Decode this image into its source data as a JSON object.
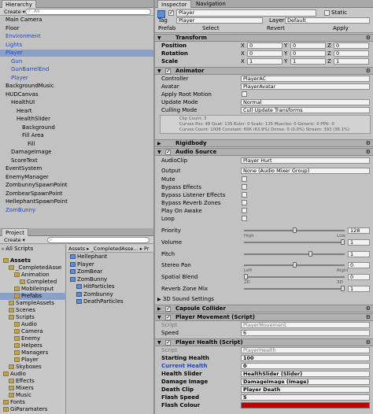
{
  "hierarchy": {
    "tab": "Hierarchy",
    "create": "Create ▾",
    "search_placeholder": "All",
    "items": [
      {
        "label": "Main Camera",
        "indent": 0,
        "blue": false,
        "selected": false
      },
      {
        "label": "Floor",
        "indent": 0,
        "blue": false,
        "selected": false
      },
      {
        "label": "Environment",
        "indent": 0,
        "blue": true,
        "selected": false
      },
      {
        "label": "Lights",
        "indent": 0,
        "blue": true,
        "selected": false
      },
      {
        "label": "Player",
        "indent": 0,
        "blue": true,
        "selected": true
      },
      {
        "label": "Gun",
        "indent": 1,
        "blue": true,
        "selected": false
      },
      {
        "label": "GunBarrelEnd",
        "indent": 1,
        "blue": true,
        "selected": false
      },
      {
        "label": "Player",
        "indent": 1,
        "blue": true,
        "selected": false
      },
      {
        "label": "BackgroundMusic",
        "indent": 0,
        "blue": false,
        "selected": false
      },
      {
        "label": "HUDCanvas",
        "indent": 0,
        "blue": false,
        "selected": false
      },
      {
        "label": "HealthUI",
        "indent": 1,
        "blue": false,
        "selected": false
      },
      {
        "label": "Heart",
        "indent": 2,
        "blue": false,
        "selected": false
      },
      {
        "label": "HealthSlider",
        "indent": 2,
        "blue": false,
        "selected": false
      },
      {
        "label": "Background",
        "indent": 3,
        "blue": false,
        "selected": false
      },
      {
        "label": "Fill Area",
        "indent": 3,
        "blue": false,
        "selected": false
      },
      {
        "label": "Fill",
        "indent": 4,
        "blue": false,
        "selected": false
      },
      {
        "label": "DamageImage",
        "indent": 1,
        "blue": false,
        "selected": false
      },
      {
        "label": "ScoreText",
        "indent": 1,
        "blue": false,
        "selected": false
      },
      {
        "label": "EventSystem",
        "indent": 0,
        "blue": false,
        "selected": false
      },
      {
        "label": "EnemyManager",
        "indent": 0,
        "blue": false,
        "selected": false
      },
      {
        "label": "ZombunnySpawnPoint",
        "indent": 0,
        "blue": false,
        "selected": false
      },
      {
        "label": "ZombearSpawnPoint",
        "indent": 0,
        "blue": false,
        "selected": false
      },
      {
        "label": "HellephantSpawnPoint",
        "indent": 0,
        "blue": false,
        "selected": false
      },
      {
        "label": "ZomBunny",
        "indent": 0,
        "blue": true,
        "selected": false
      }
    ]
  },
  "project": {
    "tab": "Project",
    "create": "Create ▾",
    "favorites": "All Scripts",
    "breadcrumb": "Assets ▸ _CompletedAsse... ▸ Pr",
    "tree": [
      {
        "label": "Assets",
        "indent": 0,
        "bold": true
      },
      {
        "label": "_CompletedAsse",
        "indent": 1,
        "bold": false
      },
      {
        "label": "Animation",
        "indent": 2,
        "bold": false
      },
      {
        "label": "Completed",
        "indent": 3,
        "bold": false
      },
      {
        "label": "MobileInput",
        "indent": 2,
        "bold": false
      },
      {
        "label": "Prefabs",
        "indent": 2,
        "bold": false,
        "selected": true
      },
      {
        "label": "SampleAssets",
        "indent": 1,
        "bold": false
      },
      {
        "label": "Scenes",
        "indent": 1,
        "bold": false
      },
      {
        "label": "Scripts",
        "indent": 1,
        "bold": false
      },
      {
        "label": "Audio",
        "indent": 2,
        "bold": false
      },
      {
        "label": "Camera",
        "indent": 2,
        "bold": false
      },
      {
        "label": "Enemy",
        "indent": 2,
        "bold": false
      },
      {
        "label": "Helpers",
        "indent": 2,
        "bold": false
      },
      {
        "label": "Managers",
        "indent": 2,
        "bold": false
      },
      {
        "label": "Player",
        "indent": 2,
        "bold": false
      },
      {
        "label": "Skyboxes",
        "indent": 1,
        "bold": false
      },
      {
        "label": "Audio",
        "indent": 0,
        "bold": false
      },
      {
        "label": "Effects",
        "indent": 1,
        "bold": false
      },
      {
        "label": "Mixers",
        "indent": 1,
        "bold": false
      },
      {
        "label": "Music",
        "indent": 1,
        "bold": false
      },
      {
        "label": "Fonts",
        "indent": 0,
        "bold": false
      },
      {
        "label": "GiParamaters",
        "indent": 0,
        "bold": false
      }
    ],
    "files": [
      {
        "label": "Hellephant",
        "indent": 0
      },
      {
        "label": "Player",
        "indent": 0
      },
      {
        "label": "ZomBear",
        "indent": 0
      },
      {
        "label": "ZomBunny",
        "indent": 0
      },
      {
        "label": "HitParticles",
        "indent": 1
      },
      {
        "label": "Zombunny",
        "indent": 1
      },
      {
        "label": "DeathParticles",
        "indent": 1
      }
    ]
  },
  "inspector": {
    "tabs": [
      "Inspector",
      "Navigation"
    ],
    "object_name": "Player",
    "static_label": "Static",
    "tag_label": "Tag",
    "tag_value": "Player",
    "layer_label": "Layer",
    "layer_value": "Default",
    "prefab_label": "Prefab",
    "prefab_select": "Select",
    "prefab_revert": "Revert",
    "prefab_apply": "Apply",
    "transform": {
      "title": "Transform",
      "position": "Position",
      "rotation": "Rotation",
      "scale": "Scale",
      "pos": [
        "0",
        "0",
        "0"
      ],
      "rot": [
        "0",
        "0",
        "0"
      ],
      "scl": [
        "1",
        "1",
        "1"
      ],
      "axes": [
        "X",
        "Y",
        "Z"
      ]
    },
    "animator": {
      "title": "Animator",
      "controller_label": "Controller",
      "controller_value": "PlayerAC",
      "avatar_label": "Avatar",
      "avatar_value": "PlayerAvatar",
      "root_motion_label": "Apply Root Motion",
      "update_mode_label": "Update Mode",
      "update_mode_value": "Normal",
      "culling_label": "Culling Mode",
      "culling_value": "Cull Update Transforms",
      "info": [
        "Clip Count: 3",
        "Curves Pos: 48 Quat: 135 Euler: 0 Scale: 135 Muscles: 0 Generic: 0 PPtr: 0",
        "Curves Count: 1008 Constant: 696 (63.9%) Dense: 0 (0.0%) Stream: 393 (36.1%)"
      ]
    },
    "rigidbody": {
      "title": "Rigidbody"
    },
    "audio": {
      "title": "Audio Source",
      "clip_label": "AudioClip",
      "clip_value": "Player Hurt",
      "output_label": "Output",
      "output_value": "None (Audio Mixer Group)",
      "mute": "Mute",
      "bypass_effects": "Bypass Effects",
      "bypass_listener": "Bypass Listener Effects",
      "bypass_reverb": "Bypass Reverb Zones",
      "play_on_awake": "Play On Awake",
      "loop": "Loop",
      "priority_label": "Priority",
      "priority_value": "128",
      "priority_level": 0.5,
      "high": "High",
      "low": "Low",
      "volume_label": "Volume",
      "volume_value": "1",
      "volume_level": 1,
      "pitch_label": "Pitch",
      "pitch_value": "1",
      "pitch_level": 0.67,
      "stereo_label": "Stereo Pan",
      "stereo_value": "0",
      "stereo_level": 0.5,
      "left": "Left",
      "right": "Right",
      "spatial_label": "Spatial Blend",
      "spatial_value": "0",
      "spatial_level": 0,
      "spatial_2d": "2D",
      "spatial_3d": "3D",
      "reverb_label": "Reverb Zone Mix",
      "reverb_value": "1",
      "reverb_level": 1,
      "sound_settings": "3D Sound Settings"
    },
    "capsule": {
      "title": "Capsule Collider"
    },
    "movement": {
      "title": "Player Movement (Script)",
      "script_label": "Script",
      "script_value": "PlayerMovement",
      "speed_label": "Speed",
      "speed_value": "6"
    },
    "health": {
      "title": "Player Health (Script)",
      "script_label": "Script",
      "script_value": "PlayerHealth",
      "starting_label": "Starting Health",
      "starting_value": "100",
      "current_label": "Current Health",
      "current_value": "0",
      "slider_label": "Health Slider",
      "slider_value": "HealthSlider (Slider)",
      "damage_label": "Damage Image",
      "damage_value": "DamageImage (Image)",
      "clip_label": "Death Clip",
      "clip_value": "Player Death",
      "flash_speed_label": "Flash Speed",
      "flash_speed_value": "5",
      "flash_colour_label": "Flash Colour",
      "flash_colour_hex": "#c00000"
    }
  }
}
